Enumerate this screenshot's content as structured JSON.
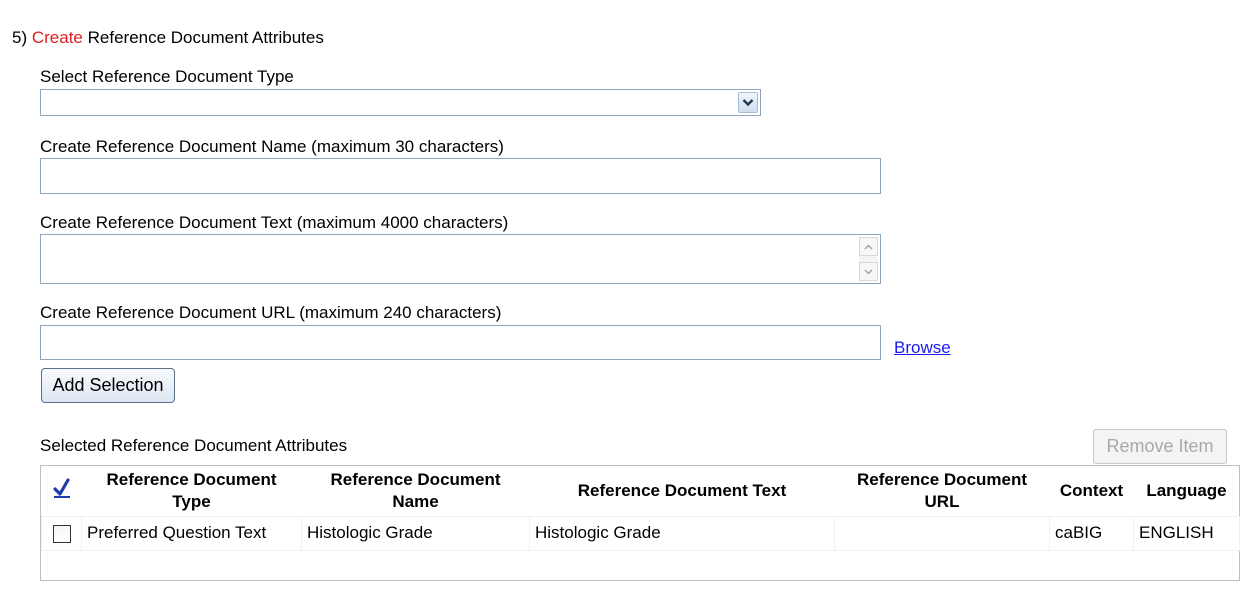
{
  "step": {
    "number": "5)",
    "action_word": "Create",
    "rest": "Reference Document Attributes"
  },
  "type_select": {
    "label": "Select Reference Document Type",
    "value": ""
  },
  "name_field": {
    "label": "Create Reference Document Name (maximum 30 characters)",
    "value": ""
  },
  "text_field": {
    "label": "Create Reference Document Text (maximum 4000 characters)",
    "value": ""
  },
  "url_field": {
    "label": "Create Reference Document URL (maximum 240 characters)",
    "value": "",
    "browse_label": "Browse"
  },
  "add_button_label": "Add Selection",
  "selected_section": {
    "label": "Selected Reference Document Attributes",
    "remove_button_label": "Remove Item"
  },
  "table": {
    "headers": {
      "type": "Reference Document Type",
      "name": "Reference Document Name",
      "text": "Reference Document Text",
      "url": "Reference Document URL",
      "context": "Context",
      "language": "Language"
    },
    "rows": [
      {
        "checked": false,
        "type": "Preferred Question Text",
        "name": "Histologic Grade",
        "text": "Histologic Grade",
        "url": "",
        "context": "caBIG",
        "language": "ENGLISH"
      }
    ]
  },
  "colors": {
    "accent_red": "#e02020",
    "link_blue": "#1a1aee",
    "checkmark_blue": "#1f3fa8"
  }
}
